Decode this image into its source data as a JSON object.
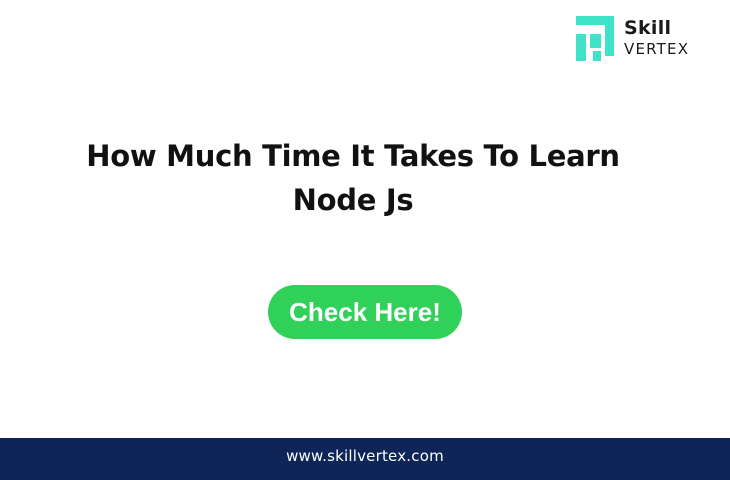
{
  "logo": {
    "line1": "Skill",
    "line2": "VERTEX",
    "mark_color": "#3ee3c8",
    "icon": "skillvertex-logo-icon"
  },
  "headline": {
    "line1": "How Much Time It Takes To Learn",
    "line2": "Node Js"
  },
  "cta": {
    "label": "Check Here!",
    "color": "#2fd158"
  },
  "footer": {
    "url": "www.skillvertex.com",
    "background": "#0f2558"
  }
}
